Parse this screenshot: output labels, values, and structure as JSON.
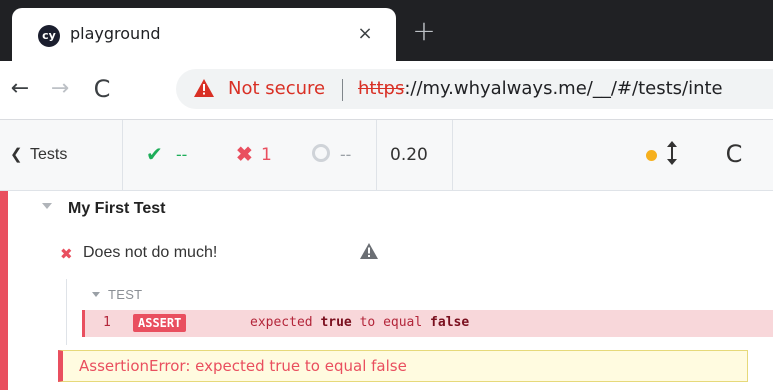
{
  "browser": {
    "tab": {
      "favicon_text": "cy",
      "title": "playground",
      "close_glyph": "×"
    },
    "new_tab_glyph": "+",
    "nav": {
      "back_glyph": "←",
      "forward_glyph": "→",
      "reload_glyph": "C"
    },
    "omnibox": {
      "security_label": "Not secure",
      "url_scheme": "https",
      "url_rest": "://my.whyalways.me/__/#/tests/inte"
    }
  },
  "reporter": {
    "header": {
      "tests_chevron": "❮",
      "tests_label": "Tests",
      "passed_glyph": "✔",
      "passed_count": "--",
      "failed_glyph": "✖",
      "failed_count": "1",
      "pending_count": "--",
      "duration": "0.20",
      "reload_glyph": "C"
    },
    "suite": {
      "title": "My First Test",
      "test": {
        "status_glyph": "✖",
        "title": "Does not do much!",
        "hook": {
          "title": "TEST",
          "command": {
            "number": "1",
            "name": "ASSERT",
            "message_prefix": "expected ",
            "message_actual": "true",
            "message_mid": " to equal ",
            "message_expected": "false"
          }
        },
        "error": "AssertionError: expected true to equal false"
      }
    }
  },
  "colors": {
    "fail": "#e94f5f",
    "pass": "#1eae5a",
    "running": "#f6b01e",
    "insecure": "#d93025"
  }
}
